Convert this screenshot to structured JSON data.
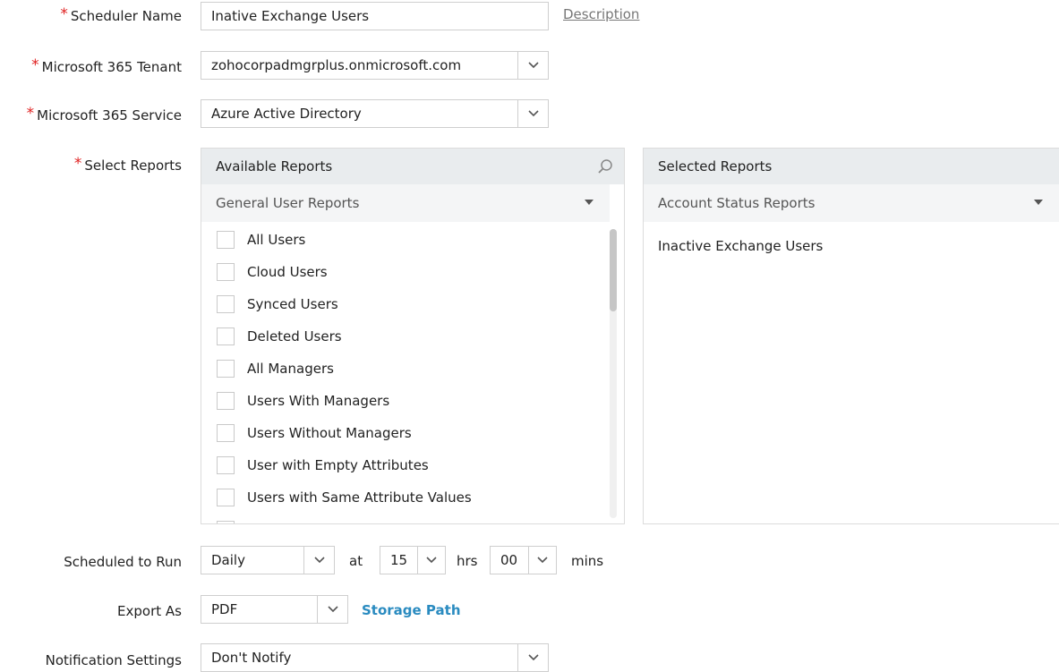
{
  "form": {
    "scheduler_name": {
      "label": "Scheduler Name",
      "value": "Inative Exchange Users",
      "link": "Description"
    },
    "tenant": {
      "label": "Microsoft 365 Tenant",
      "value": "zohocorpadmgrplus.onmicrosoft.com"
    },
    "service": {
      "label": "Microsoft 365 Service",
      "value": "Azure Active Directory"
    },
    "reports": {
      "label": "Select Reports",
      "available": {
        "title": "Available Reports",
        "category": "General User Reports",
        "items": [
          "All Users",
          "Cloud Users",
          "Synced Users",
          "Deleted Users",
          "All Managers",
          "Users With Managers",
          "Users Without Managers",
          "User with Empty Attributes",
          "Users with Same Attribute Values"
        ]
      },
      "selected": {
        "title": "Selected Reports",
        "category": "Account Status Reports",
        "items": [
          "Inactive Exchange Users"
        ]
      }
    },
    "schedule": {
      "label": "Scheduled to Run",
      "frequency": "Daily",
      "at": "at",
      "hours": "15",
      "hrs": "hrs",
      "minutes": "00",
      "mins": "mins"
    },
    "export": {
      "label": "Export As",
      "value": "PDF",
      "link": "Storage Path"
    },
    "notification": {
      "label": "Notification Settings",
      "value": "Don't Notify"
    }
  },
  "colors": {
    "required": "#e02020",
    "link": "#2a8bc0",
    "panel_header": "#e9ecee"
  },
  "icons": {
    "dropdown": "chevron-down-icon",
    "search": "search-icon",
    "category": "caret-down-icon"
  }
}
